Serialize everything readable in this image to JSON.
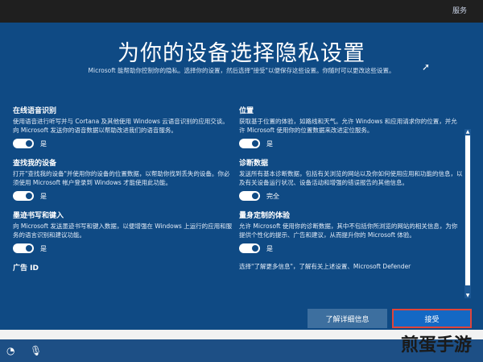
{
  "topbar": {
    "service_label": "服务"
  },
  "header": {
    "title": "为你的设备选择隐私设置",
    "subtitle": "Microsoft 能帮助你控制你的隐私。选择你的设置，然后选择\"接受\"以便保存这些设置。你随时可以更改这些设置。"
  },
  "settings_left": [
    {
      "title": "在线语音识别",
      "description": "使用语音进行听写并与 Cortana 及其他使用 Windows 云语音识别的应用交谈。向 Microsoft 发送你的语音数据以帮助改进我们的语音服务。",
      "toggle_label": "是"
    },
    {
      "title": "查找我的设备",
      "description": "打开\"查找我的设备\"并使用你的设备的位置数据，以帮助你找到丢失的设备。你必须使用 Microsoft 帐户登录到 Windows 才能使用此功能。",
      "toggle_label": "是"
    },
    {
      "title": "墨迹书写和键入",
      "description": "向 Microsoft 发送墨迹书写和键入数据，以便增强在 Windows 上运行的应用和服务的语言识别和建议功能。",
      "toggle_label": "是"
    },
    {
      "title": "广告 ID",
      "description": "",
      "toggle_label": ""
    }
  ],
  "settings_right": [
    {
      "title": "位置",
      "description": "获取基于位置的体验，如路线和天气。允许 Windows 和应用请求你的位置，并允许 Microsoft 使用你的位置数据来改进定位服务。",
      "toggle_label": "是"
    },
    {
      "title": "诊断数据",
      "description": "发送所有基本诊断数据，包括有关浏览的网站以及你如何使用应用和功能的信息，以及有关设备运行状况、设备活动和增强的错误报告的其他信息。",
      "toggle_label": "完全"
    },
    {
      "title": "量身定制的体验",
      "description": "允许 Microsoft 使用你的诊断数据，其中不包括你所浏览的网站的相关信息，为你提供个性化的提示、广告和建议，从而提升你的 Microsoft 体验。",
      "toggle_label": "是"
    },
    {
      "title": "",
      "description": "选择\"了解更多信息\"，了解有关上述设置、Microsoft Defender",
      "toggle_label": ""
    }
  ],
  "footer": {
    "learn_more_label": "了解详细信息",
    "accept_label": "接受"
  },
  "watermark": "煎蛋手游",
  "icons": {
    "taskbar_1": "ease-of-access-icon",
    "taskbar_2": "microphone-icon"
  }
}
